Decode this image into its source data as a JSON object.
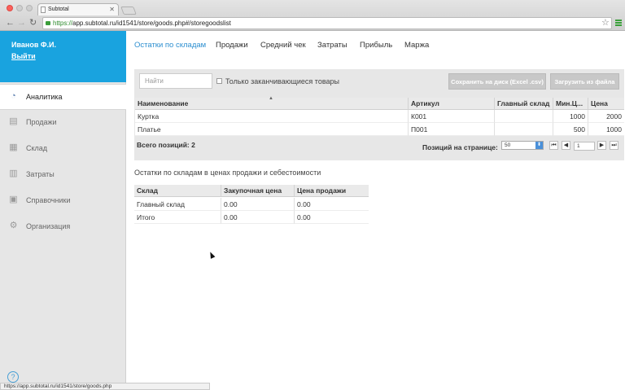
{
  "browser": {
    "tab_title": "Subtotal",
    "url_scheme": "https://",
    "url_rest": "app.subtotal.ru/id1541/store/goods.php#/storegoodslist",
    "status_url": "https://app.subtotal.ru/id1541/store/goods.php"
  },
  "user": {
    "name": "Иванов Ф.И.",
    "logout": "Выйти"
  },
  "sidebar": {
    "items": [
      {
        "label": "Аналитика",
        "icon": "analytics-icon"
      },
      {
        "label": "Продажи",
        "icon": "sales-icon"
      },
      {
        "label": "Склад",
        "icon": "warehouse-icon"
      },
      {
        "label": "Затраты",
        "icon": "costs-icon"
      },
      {
        "label": "Справочники",
        "icon": "reference-icon"
      },
      {
        "label": "Организация",
        "icon": "gear-icon"
      }
    ],
    "help": "?"
  },
  "topnav": {
    "items": [
      "Остатки по складам",
      "Продажи",
      "Средний чек",
      "Затраты",
      "Прибыль",
      "Маржа"
    ]
  },
  "toolbar": {
    "search_placeholder": "Найти",
    "only_ending_label": "Только заканчивающиеся товары",
    "save_button": "Сохранить на диск (Excel .csv)",
    "load_button": "Загрузить из файла"
  },
  "goods_table": {
    "headers": [
      "Наименование",
      "Артикул",
      "Главный склад",
      "Мин.Ц...",
      "Цена"
    ],
    "rows": [
      [
        "Куртка",
        "К001",
        "",
        "1000",
        "2000"
      ],
      [
        "Платье",
        "П001",
        "",
        "500",
        "1000"
      ]
    ]
  },
  "pagination": {
    "total_label": "Всего позиций: 2",
    "per_page_label": "Позиций на странице:",
    "per_page_value": "50",
    "page_value": "1"
  },
  "stock_summary": {
    "title": "Остатки по складам в ценах продажи и себестоимости",
    "headers": [
      "Склад",
      "Закупочная цена",
      "Цена продажи"
    ],
    "rows": [
      [
        "Главный склад",
        "0.00",
        "0.00"
      ],
      [
        "Итого",
        "0.00",
        "0.00"
      ]
    ]
  },
  "colors": {
    "accent": "#19a3df",
    "link_active": "#2d8fd0"
  }
}
